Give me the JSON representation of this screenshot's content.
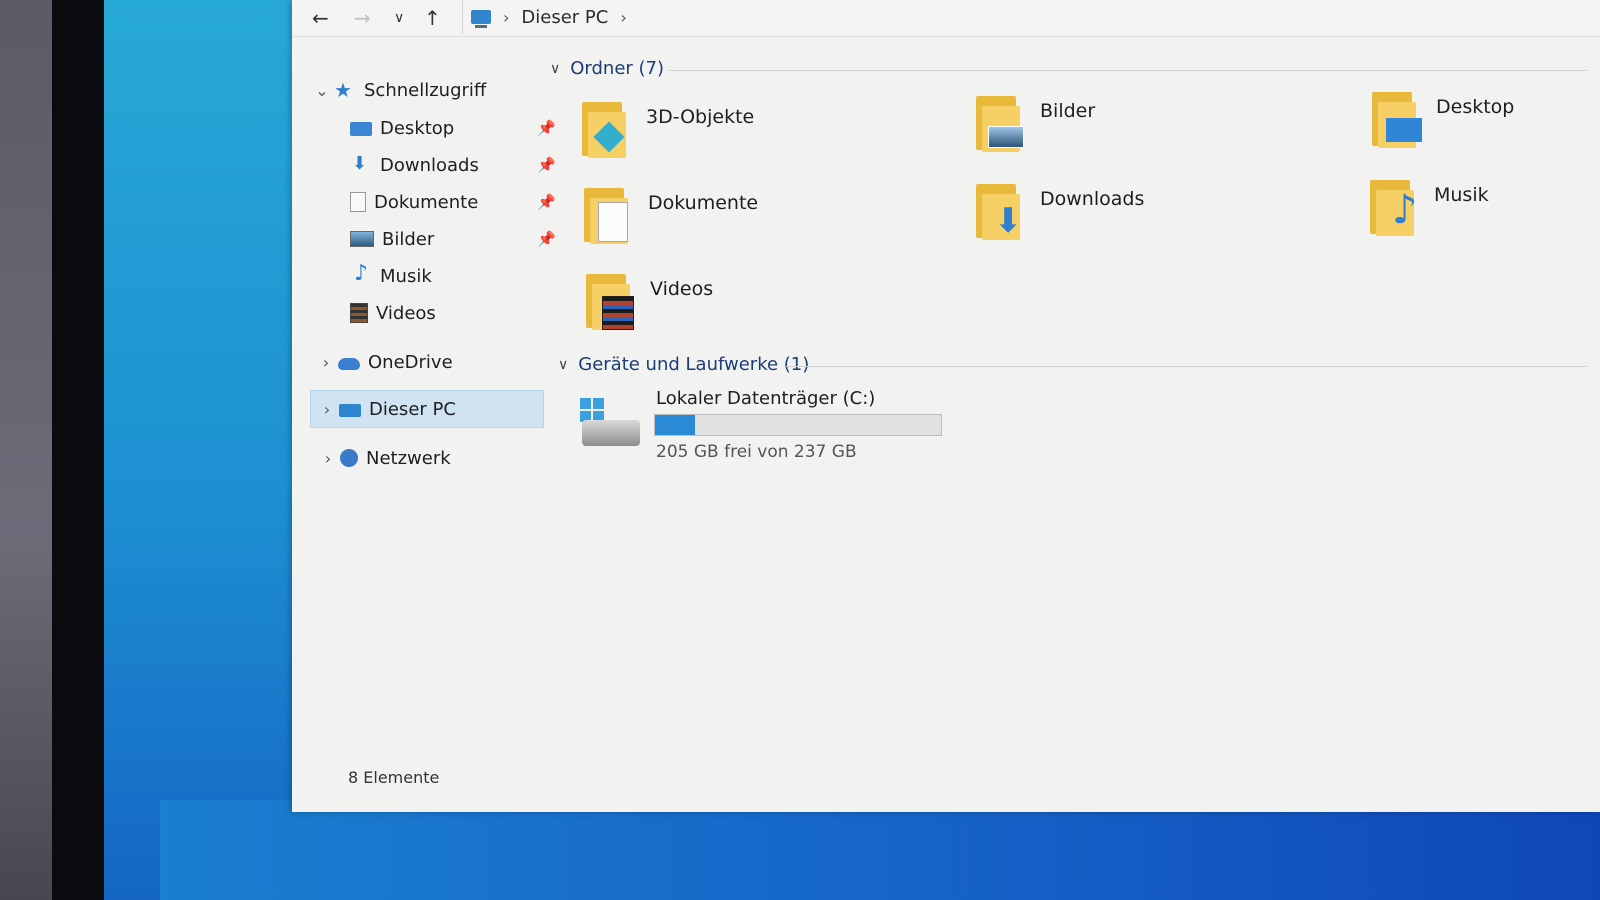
{
  "address": {
    "path": [
      "Dieser PC"
    ]
  },
  "sidebar": {
    "items": [
      {
        "label": "Schnellzugriff",
        "icon": "star-icon",
        "pinned": false
      },
      {
        "label": "Desktop",
        "icon": "desktop-icon",
        "pinned": true
      },
      {
        "label": "Downloads",
        "icon": "download-icon",
        "pinned": true
      },
      {
        "label": "Dokumente",
        "icon": "document-icon",
        "pinned": true
      },
      {
        "label": "Bilder",
        "icon": "picture-icon",
        "pinned": true
      },
      {
        "label": "Musik",
        "icon": "music-icon",
        "pinned": false
      },
      {
        "label": "Videos",
        "icon": "video-icon",
        "pinned": false
      },
      {
        "label": "OneDrive",
        "icon": "cloud-icon",
        "pinned": false
      },
      {
        "label": "Dieser PC",
        "icon": "computer-icon",
        "pinned": false,
        "selected": true
      },
      {
        "label": "Netzwerk",
        "icon": "network-icon",
        "pinned": false
      }
    ]
  },
  "content": {
    "folders_header": "Ordner (7)",
    "folders": [
      {
        "name": "3D-Objekte",
        "icon": "folder-3d-icon"
      },
      {
        "name": "Bilder",
        "icon": "folder-pictures-icon"
      },
      {
        "name": "Desktop",
        "icon": "folder-desktop-icon"
      },
      {
        "name": "Dokumente",
        "icon": "folder-documents-icon"
      },
      {
        "name": "Downloads",
        "icon": "folder-downloads-icon"
      },
      {
        "name": "Musik",
        "icon": "folder-music-icon"
      },
      {
        "name": "Videos",
        "icon": "folder-videos-icon"
      }
    ],
    "drives_header": "Geräte und Laufwerke (1)",
    "drive": {
      "name": "Lokaler Datenträger (C:)",
      "free_text": "205 GB frei von 237 GB",
      "used_fraction": 0.14
    }
  },
  "status": {
    "count": "8 Elemente"
  },
  "colors": {
    "accent": "#2a8ad6",
    "selection": "#cfe3f2",
    "folder": "#f6d064"
  }
}
